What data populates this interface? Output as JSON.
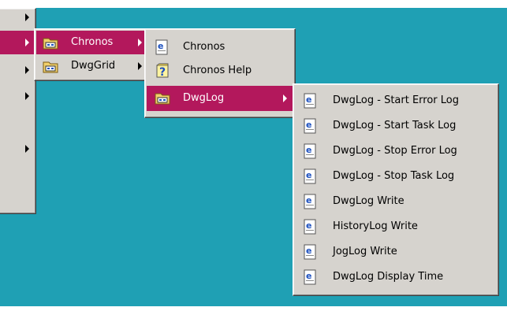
{
  "menu_level1": {
    "items": [
      "",
      "",
      "",
      "",
      ""
    ]
  },
  "menu_level2": {
    "items": [
      {
        "label": "Chronos",
        "icon": "program-group-folder-icon"
      },
      {
        "label": "DwgGrid",
        "icon": "program-group-folder-icon"
      }
    ]
  },
  "menu_level3": {
    "items": [
      {
        "label": "Chronos",
        "icon": "program-icon"
      },
      {
        "label": "Chronos Help",
        "icon": "help-file-icon"
      },
      {
        "label": "DwgLog",
        "icon": "program-group-folder-icon"
      }
    ]
  },
  "menu_level4": {
    "items": [
      {
        "label": "DwgLog - Start Error Log",
        "icon": "program-icon"
      },
      {
        "label": "DwgLog - Start Task Log",
        "icon": "program-icon"
      },
      {
        "label": "DwgLog - Stop Error Log",
        "icon": "program-icon"
      },
      {
        "label": "DwgLog - Stop Task Log",
        "icon": "program-icon"
      },
      {
        "label": "DwgLog Write",
        "icon": "program-icon"
      },
      {
        "label": "HistoryLog Write",
        "icon": "program-icon"
      },
      {
        "label": "JogLog Write",
        "icon": "program-icon"
      },
      {
        "label": "DwgLog Display Time",
        "icon": "program-icon"
      }
    ]
  },
  "colors": {
    "desktop": "#1fa0b4",
    "menu_face": "#d6d3ce",
    "highlight": "#b3185c",
    "highlight_text": "#ffffff"
  }
}
